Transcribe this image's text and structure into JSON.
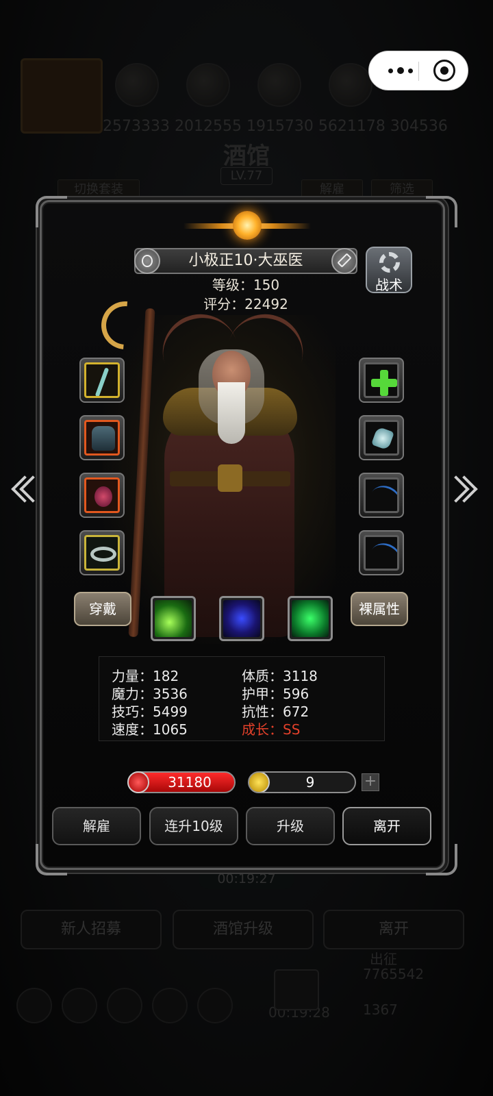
{
  "background": {
    "resource_numbers": "2573333  2012555  1915730  5621178  304536",
    "tavern_title": "酒馆",
    "tavern_level": "LV.77",
    "switch_outfit_tab": "切换套装",
    "dismiss_tab": "解雇",
    "filter_tab": "筛选",
    "timer_top": "00:19:27",
    "recruit_button": "新人招募",
    "upgrade_tavern_button": "酒馆升级",
    "leave_button": "离开",
    "deploy_label": "出征",
    "gold_value": "7765542",
    "timer_bottom": "00:19:28",
    "gem_value": "1367"
  },
  "hero": {
    "name": "小极正10·大巫医",
    "level_line": "等级：150",
    "score_line": "评分：22492",
    "tactics_label": "战术"
  },
  "buttons": {
    "wear": "穿戴",
    "base_attributes": "裸属性"
  },
  "stats": {
    "strength": "力量：182",
    "constitution": "体质：3118",
    "magic": "魔力：3536",
    "armor": "护甲：596",
    "skill": "技巧：5499",
    "resistance": "抗性：672",
    "speed": "速度：1065",
    "growth": "成长：SS"
  },
  "vitals": {
    "hp": "31180",
    "energy": "9",
    "energy_fraction": 0.06
  },
  "actions": {
    "dismiss": "解雇",
    "level_up_10": "连升10级",
    "level_up": "升级",
    "leave": "离开"
  },
  "icons": {
    "equip_slots": [
      "staff-icon",
      "armor-icon",
      "amulet-icon",
      "ring-icon"
    ],
    "accessory_slots": [
      "add-slot-icon",
      "gem-icon",
      "arc-icon",
      "arc-icon"
    ],
    "skills": [
      "green-strike-skill-icon",
      "blue-shadow-skill-icon",
      "green-cross-skill-icon"
    ]
  },
  "colors": {
    "growth": "#e2402a",
    "hp_bar": "#d81414",
    "energy_bar": "#ffd84a",
    "accent_gold": "#ffb12a"
  }
}
